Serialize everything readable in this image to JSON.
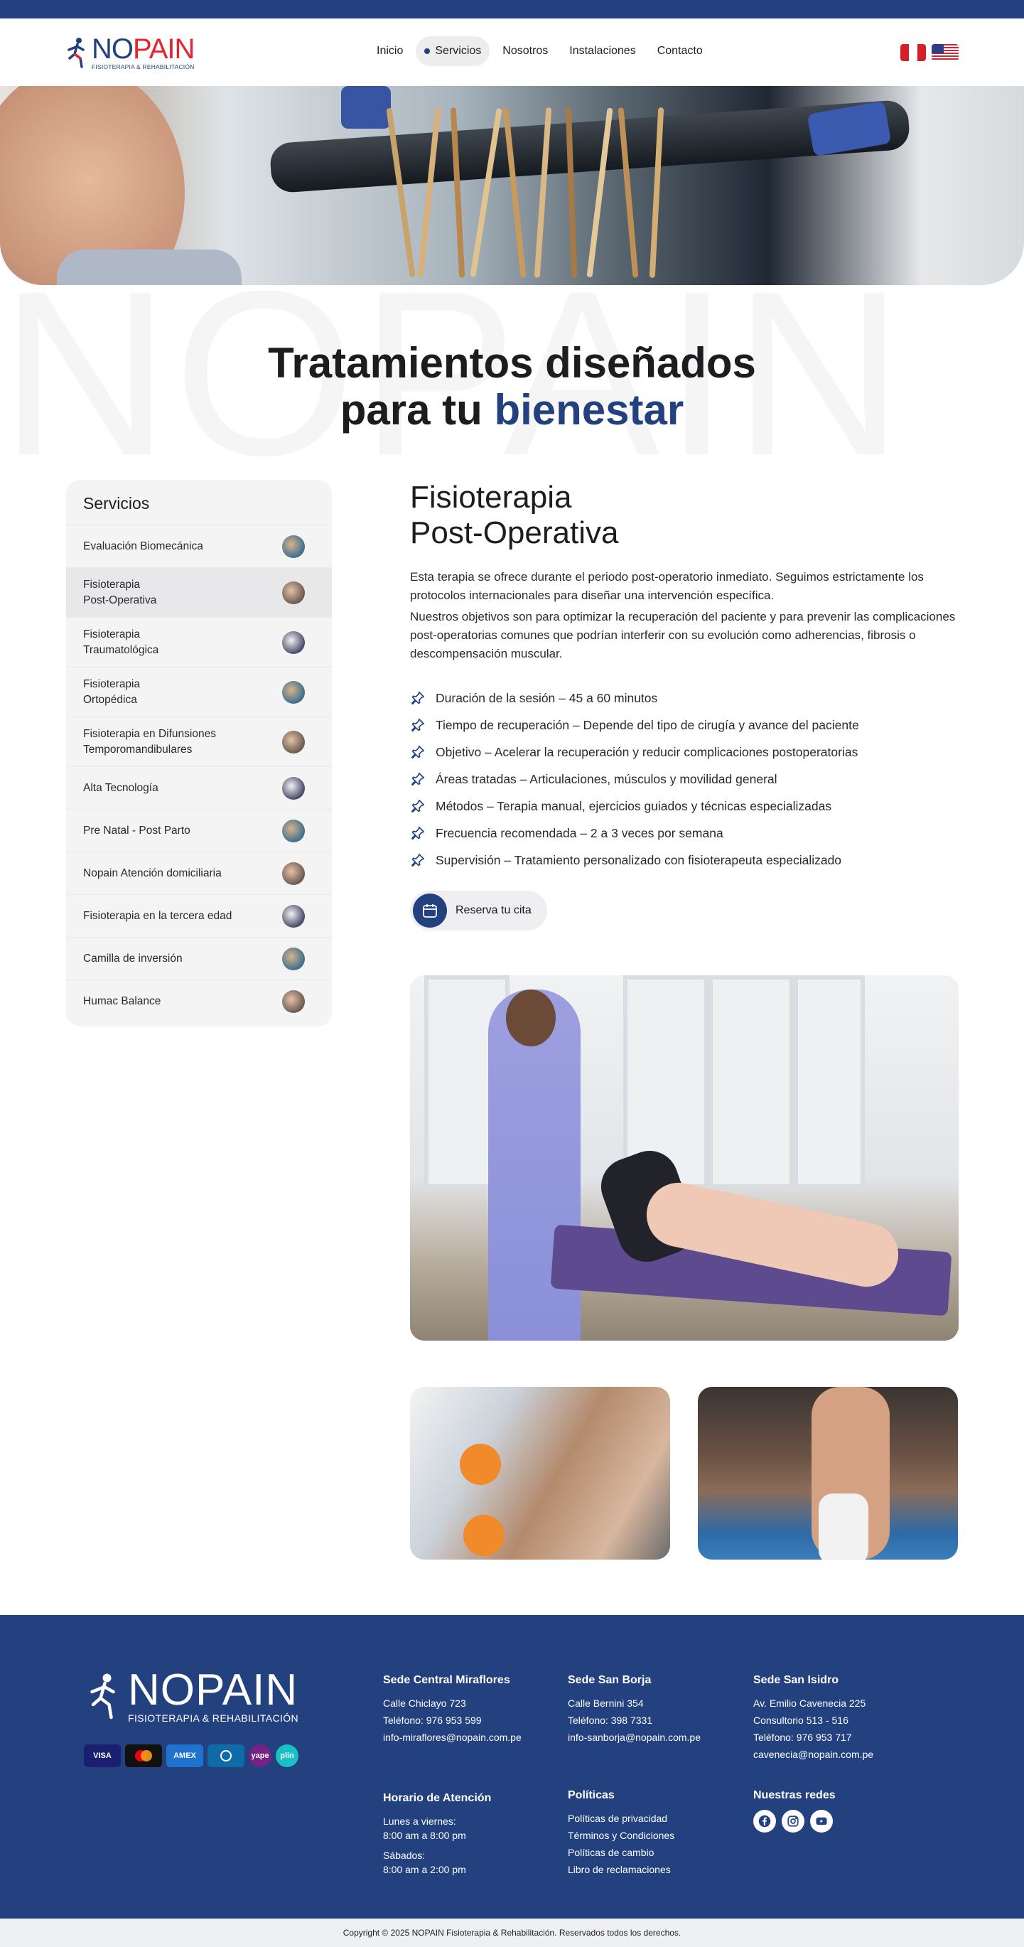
{
  "brand": {
    "name_part1": "NO",
    "name_part2": "PAIN",
    "tagline": "FISIOTERAPIA & REHABILITACIÓN",
    "colors": {
      "primary": "#23407f",
      "accent_red": "#e3262f"
    }
  },
  "nav": {
    "items": [
      {
        "label": "Inicio"
      },
      {
        "label": "Servicios",
        "active": true
      },
      {
        "label": "Nosotros"
      },
      {
        "label": "Instalaciones"
      },
      {
        "label": "Contacto"
      }
    ],
    "languages": [
      "peru-flag-icon",
      "us-flag-icon"
    ]
  },
  "hero": {
    "headline_line1": "Tratamientos diseñados",
    "headline_line2_pre": "para tu ",
    "headline_line2_accent": "bienestar"
  },
  "sidebar": {
    "title": "Servicios",
    "items": [
      {
        "label": "Evaluación Biomecánica"
      },
      {
        "label": "Fisioterapia\nPost-Operativa",
        "active": true
      },
      {
        "label": "Fisioterapia\nTraumatológica"
      },
      {
        "label": "Fisioterapia\nOrtopédica"
      },
      {
        "label": "Fisioterapia en Difunsiones\nTemporomandibulares"
      },
      {
        "label": "Alta Tecnología"
      },
      {
        "label": "Pre Natal - Post Parto"
      },
      {
        "label": "Nopain Atención domiciliaria"
      },
      {
        "label": "Fisioterapia en la tercera edad"
      },
      {
        "label": "Camilla de inversión"
      },
      {
        "label": "Humac Balance"
      }
    ]
  },
  "service": {
    "title_line1": "Fisioterapia",
    "title_line2": "Post-Operativa",
    "paragraph1": "Esta terapia se ofrece durante el periodo post-operatorio inmediato. Seguimos estrictamente los protocolos internacionales para diseñar una intervención específica.",
    "paragraph2": "Nuestros objetivos son para optimizar la recuperación del paciente y para prevenir las complicaciones post-operatorias comunes que podrían interferir con su evolución como adherencias, fibrosis o descompensación muscular.",
    "features": [
      "Duración de la sesión – 45 a 60 minutos",
      "Tiempo de recuperación – Depende del tipo de cirugía y avance del paciente",
      "Objetivo – Acelerar la recuperación y reducir complicaciones postoperatorias",
      "Áreas tratadas – Articulaciones, músculos y movilidad general",
      "Métodos – Terapia manual, ejercicios guiados y técnicas especializadas",
      "Frecuencia recomendada – 2 a 3 veces por semana",
      "Supervisión – Tratamiento personalizado con fisioterapeuta especializado"
    ],
    "cta_label": "Reserva tu cita"
  },
  "footer": {
    "logo_word": "NOPAIN",
    "logo_sub": "FISIOTERAPIA & REHABILITACIÓN",
    "payments": [
      "VISA",
      "",
      "AMEX",
      "",
      "yape",
      "plin"
    ],
    "sedes": [
      {
        "title": "Sede Central Miraflores",
        "lines": [
          "Calle Chiclayo 723",
          "Teléfono: 976 953 599",
          "info-miraflores@nopain.com.pe"
        ]
      },
      {
        "title": "Sede San Borja",
        "lines": [
          "Calle Bernini 354",
          "Teléfono: 398 7331",
          "info-sanborja@nopain.com.pe"
        ]
      },
      {
        "title": "Sede San Isidro",
        "lines": [
          "Av. Emilio Cavenecia 225",
          "Consultorio 513 - 516",
          "Teléfono: 976 953 717",
          "cavenecia@nopain.com.pe"
        ]
      }
    ],
    "horario": {
      "title": "Horario de Atención",
      "weekday_label": "Lunes a viernes:",
      "weekday_hours": "8:00 am a 8:00 pm",
      "saturday_label": "Sábados:",
      "saturday_hours": "8:00 am a 2:00 pm"
    },
    "politicas": {
      "title": "Políticas",
      "links": [
        "Políticas de privacidad",
        "Términos y Condiciones",
        "Políticas de cambio",
        "Libro de reclamaciones"
      ]
    },
    "redes": {
      "title": "Nuestras redes",
      "icons": [
        "facebook-icon",
        "instagram-icon",
        "youtube-icon"
      ]
    }
  },
  "copyright": "Copyright © 2025 NOPAIN Fisioterapia & Rehabilitación. Reservados todos los derechos."
}
